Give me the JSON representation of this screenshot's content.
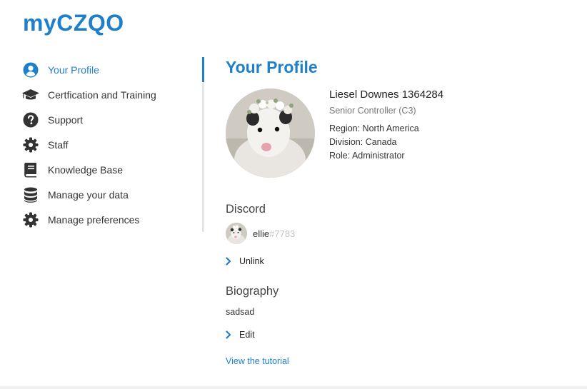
{
  "brand": {
    "title": "myCZQO"
  },
  "colors": {
    "accent": "#1f7fc9",
    "text": "#333333",
    "muted": "#777777",
    "tag": "#c4c4c4"
  },
  "sidebar": {
    "items": [
      {
        "label": "Your Profile",
        "icon": "user-circle-icon",
        "active": true
      },
      {
        "label": "Certfication and Training",
        "icon": "graduation-cap-icon"
      },
      {
        "label": "Support",
        "icon": "question-circle-icon"
      },
      {
        "label": "Staff",
        "icon": "gear-icon"
      },
      {
        "label": "Knowledge Base",
        "icon": "book-icon"
      },
      {
        "label": "Manage your data",
        "icon": "database-icon"
      },
      {
        "label": "Manage preferences",
        "icon": "gear-icon"
      }
    ]
  },
  "main": {
    "title": "Your Profile",
    "profile": {
      "name": "Liesel Downes 1364284",
      "rating": "Senior Controller (C3)",
      "region": "Region: North America",
      "division": "Division: Canada",
      "role": "Role: Administrator"
    },
    "discord": {
      "heading": "Discord",
      "username": "ellie",
      "tag": "#7783",
      "unlink_label": "Unlink"
    },
    "biography": {
      "heading": "Biography",
      "text": "sadsad",
      "edit_label": "Edit"
    },
    "tutorial_label": "View the tutorial"
  }
}
